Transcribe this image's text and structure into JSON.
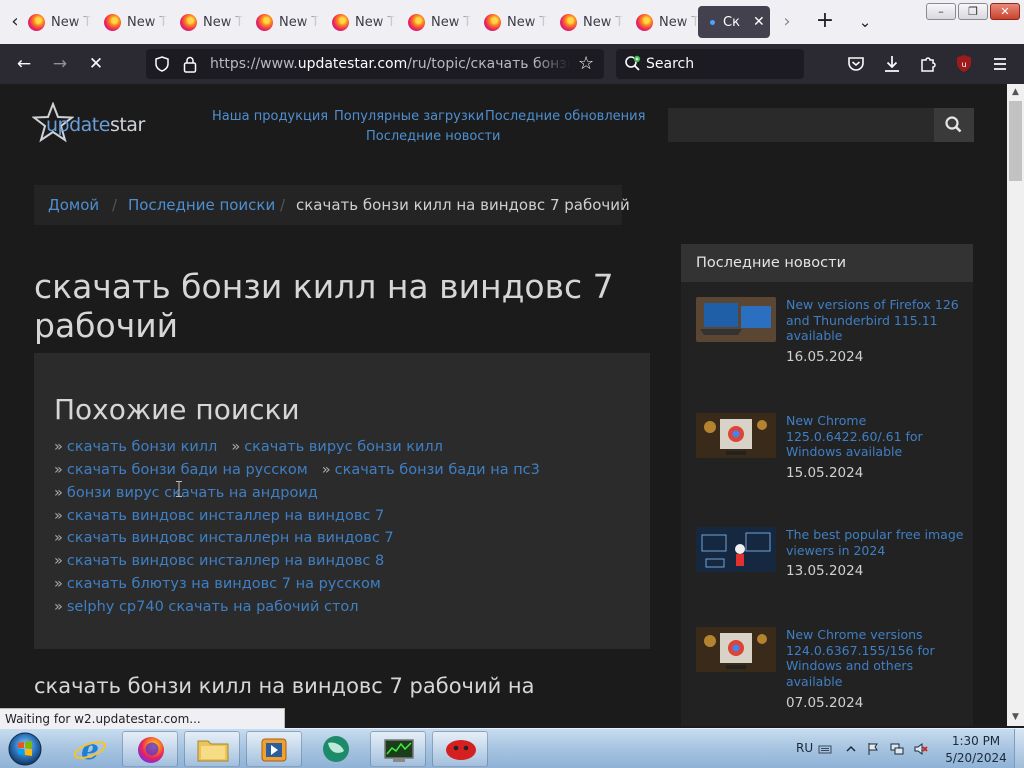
{
  "browser": {
    "tabs": [
      {
        "title": "New Tab"
      },
      {
        "title": "New Tab"
      },
      {
        "title": "New Tab"
      },
      {
        "title": "New Tab"
      },
      {
        "title": "New Tab"
      },
      {
        "title": "New Tab"
      },
      {
        "title": "New Tab"
      },
      {
        "title": "New Tab"
      },
      {
        "title": "New Tab"
      }
    ],
    "active_tab": {
      "title": "Ск"
    },
    "url": {
      "scheme": "https://www.",
      "host": "updatestar.com",
      "path": "/ru/topic/скачать бонзи килл на"
    },
    "search_placeholder": "Search",
    "ublock_count": "2",
    "status_text": "Waiting for w2.updatestar.com..."
  },
  "site": {
    "logo": {
      "prefix": "update",
      "suffix": "star"
    },
    "nav": {
      "products": "Наша продукция",
      "popular": "Популярные загрузки",
      "updates": "Последние обновления",
      "news": "Последние новости"
    },
    "breadcrumb": {
      "home": "Домой",
      "recent": "Последние поиски",
      "current": "скачать бонзи килл на виндовс 7 рабочий",
      "separator": "/"
    },
    "title": "скачать бонзи килл на виндовс 7 рабочий",
    "similar": {
      "heading": "Похожие поиски",
      "bullet": "»",
      "rows": [
        [
          "скачать бонзи килл",
          "скачать вирус бонзи килл"
        ],
        [
          "скачать бонзи бади на русском",
          "скачать бонзи бади на пс3"
        ],
        [
          "бонзи вирус скачать на андроид"
        ],
        [
          "скачать виндовс инсталлер на виндовс 7"
        ],
        [
          "скачать виндовс инсталлерн на виндовс 7"
        ],
        [
          "скачать виндовс инсталлер на виндовс 8"
        ],
        [
          "скачать блютуз на виндовс 7 на русском"
        ],
        [
          "selphy cp740 скачать на рабочий стол"
        ]
      ]
    },
    "section_heading": "скачать бонзи килл на виндовс 7 рабочий на",
    "news": {
      "header": "Последние новости",
      "items": [
        {
          "title": "New versions of Firefox 126 and Thunderbird 115.11 available",
          "date": "16.05.2024",
          "thumb": "laptop"
        },
        {
          "title": "New Chrome 125.0.6422.60/.61 for Windows available",
          "date": "15.05.2024",
          "thumb": "chrome"
        },
        {
          "title": "The best popular free image viewers in 2024",
          "date": "13.05.2024",
          "thumb": "viewer"
        },
        {
          "title": "New Chrome versions 124.0.6367.155/156 for Windows and others available",
          "date": "07.05.2024",
          "thumb": "chrome"
        }
      ]
    }
  },
  "taskbar": {
    "apps": [
      "internet-explorer",
      "firefox",
      "file-explorer",
      "media-player",
      "maps",
      "task-manager",
      "red-app"
    ],
    "lang": "RU",
    "time": "1:30 PM",
    "date": "5/20/2024"
  },
  "colors": {
    "link": "#4f8fd0",
    "page_bg": "#1b1b1b",
    "panel_bg": "#2b2b2b",
    "toolbar_bg": "#2b2a33"
  }
}
